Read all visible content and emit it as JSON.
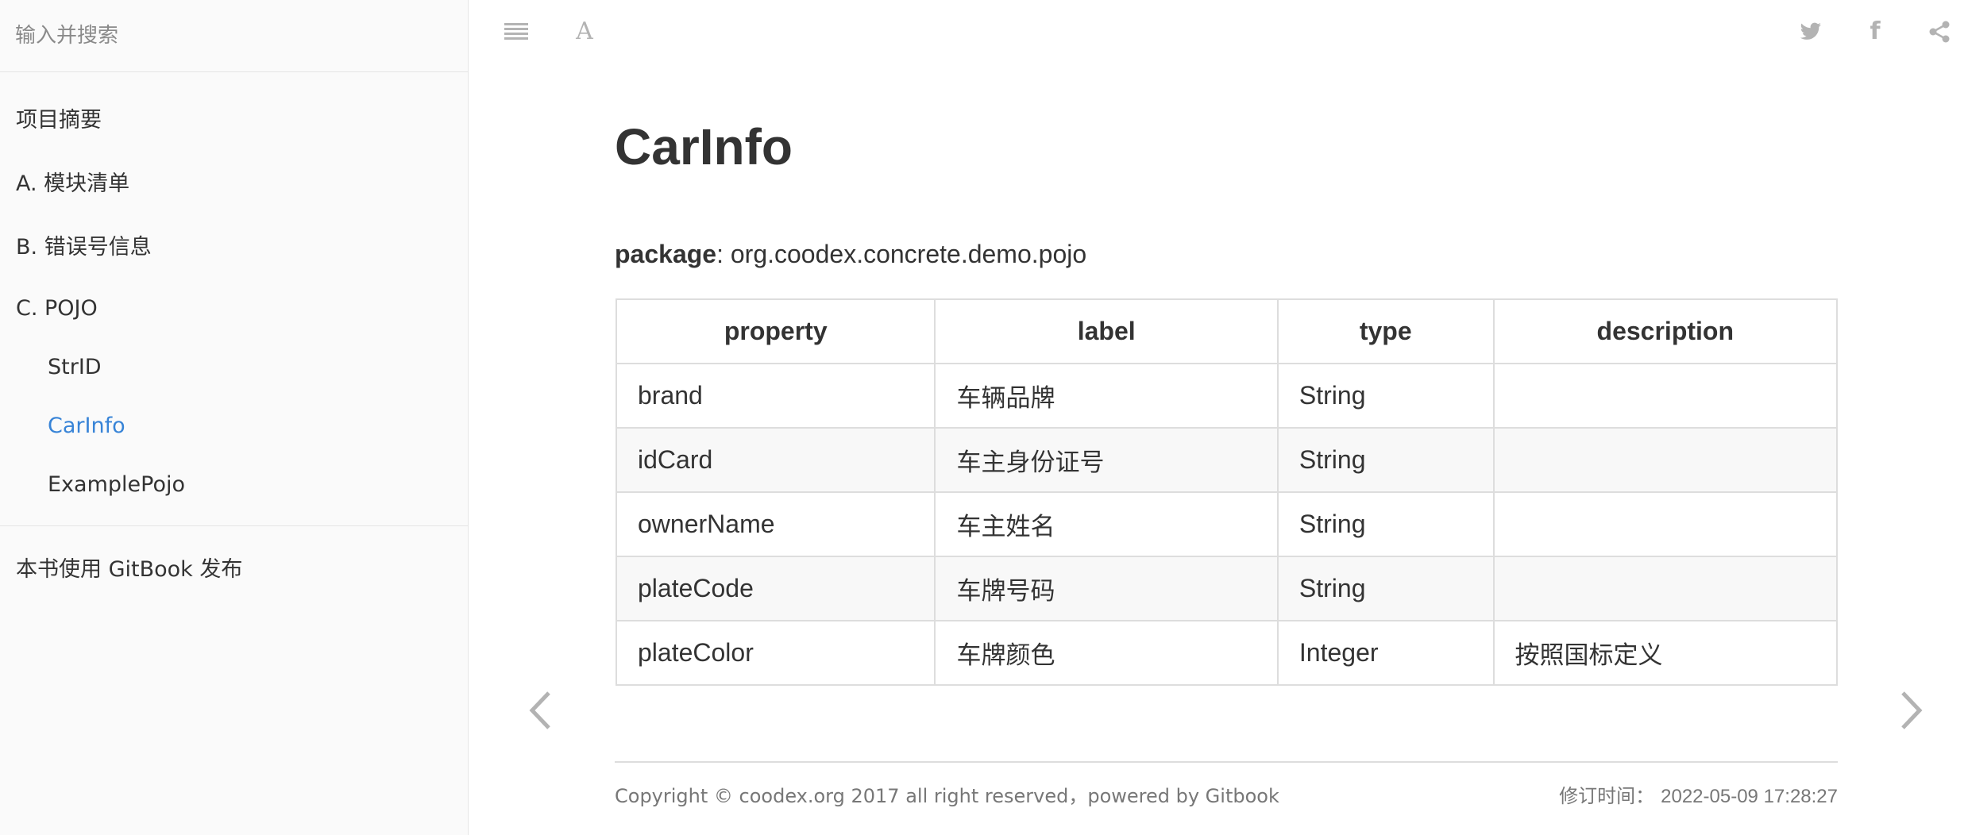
{
  "search": {
    "placeholder": "输入并搜索"
  },
  "sidebar": {
    "items": [
      {
        "label": "项目摘要"
      },
      {
        "label": "A. 模块清单"
      },
      {
        "label": "B. 错误号信息"
      },
      {
        "label": "C. POJO"
      },
      {
        "label": "StrID"
      },
      {
        "label": "CarInfo"
      },
      {
        "label": "ExamplePojo"
      }
    ],
    "footer_link": "本书使用 GitBook 发布"
  },
  "header": {
    "icons": [
      "menu-icon",
      "font-settings-icon",
      "twitter-icon",
      "facebook-icon",
      "share-icon"
    ],
    "font_button_glyph": "A",
    "facebook_glyph": "f"
  },
  "page": {
    "title": "CarInfo",
    "package_label": "package",
    "package_value": ": org.coodex.concrete.demo.pojo"
  },
  "table": {
    "headers": [
      "property",
      "label",
      "type",
      "description"
    ],
    "rows": [
      [
        "brand",
        "车辆品牌",
        "String",
        ""
      ],
      [
        "idCard",
        "车主身份证号",
        "String",
        ""
      ],
      [
        "ownerName",
        "车主姓名",
        "String",
        ""
      ],
      [
        "plateCode",
        "车牌号码",
        "String",
        ""
      ],
      [
        "plateColor",
        "车牌颜色",
        "Integer",
        "按照国标定义"
      ]
    ]
  },
  "footer": {
    "copyright": "Copyright © coodex.org 2017 all right reserved，powered by Gitbook",
    "revised_label": "修订时间：",
    "revised_time": "2022-05-09 17:28:27"
  },
  "colors": {
    "accent": "#3884d7",
    "icon_gray": "#b3b3b3",
    "sidebar_bg": "#fafafa"
  }
}
